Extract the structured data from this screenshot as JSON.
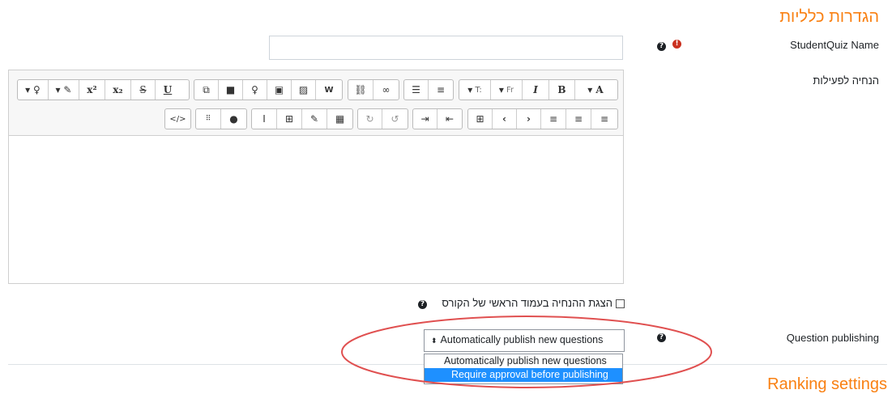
{
  "general": {
    "section_title": "הגדרות כלליות",
    "name_label": "StudentQuiz Name",
    "name_value": "",
    "intro_label": "הנחיה לפעילות",
    "show_description_label": "הצגת ההנחיה בעמוד הראשי של הקורס",
    "publishing_label": "Question publishing",
    "publishing_selected": "Automatically publish new questions",
    "publishing_options": [
      "Automatically publish new questions",
      "Require approval before publishing"
    ]
  },
  "ranking": {
    "section_title": "Ranking settings"
  },
  "toolbar": {
    "row1": [
      [
        "▾ A",
        "B",
        "I",
        "▾ Fr",
        "▾ T:"
      ],
      [
        "bullet-list-icon",
        "numbered-list-icon"
      ],
      [
        "link-icon",
        "unlink-icon"
      ],
      [
        "word-icon",
        "image-icon",
        "media-icon",
        "record-audio-icon",
        "record-video-icon",
        "copy-icon"
      ],
      [
        "U",
        "S",
        "x₂",
        "x²",
        "▾ brush",
        "▾ bulb"
      ]
    ],
    "row2": [
      [
        "align-left-icon",
        "align-center-icon",
        "align-right-icon",
        "rtl-icon",
        "ltr-icon",
        "special-char-icon"
      ],
      [
        "indent-icon",
        "outdent-icon"
      ],
      [
        "undo-icon",
        "redo-icon"
      ],
      [
        "equation-icon",
        "manage-files-icon",
        "table-icon",
        "clear-format-icon"
      ],
      [
        "accessibility-icon",
        "screenreader-icon"
      ],
      [
        "html-icon"
      ]
    ]
  },
  "colors": {
    "section_title": "#f98012",
    "highlight": "#1e90ff",
    "annotation_ellipse": "#e05050",
    "required": "#ca3120"
  }
}
